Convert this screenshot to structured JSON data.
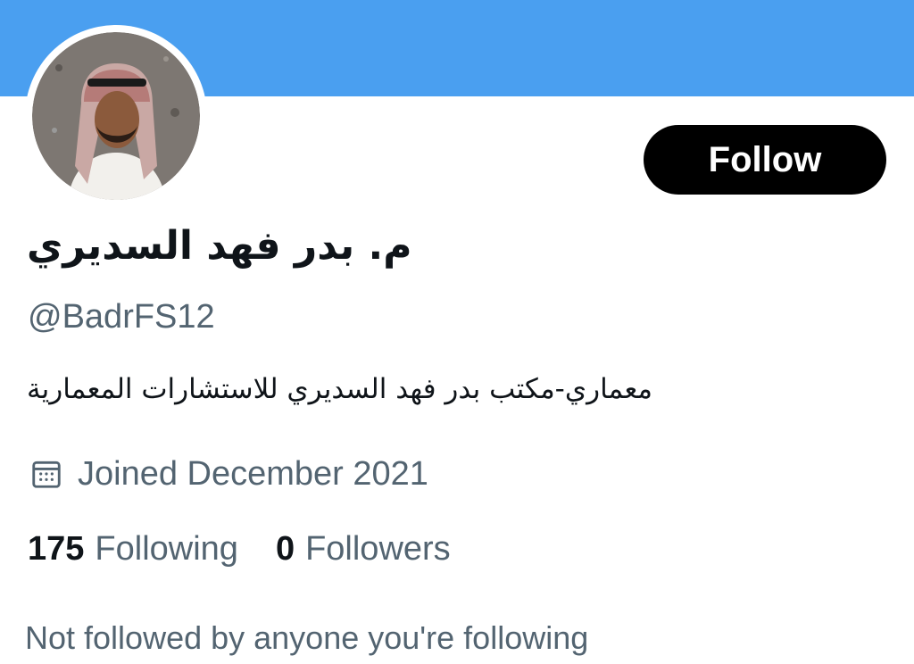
{
  "profile": {
    "display_name": "م. بدر فهد السديري",
    "handle": "@BadrFS12",
    "bio": "معماري-مكتب بدر فهد السديري للاستشارات المعمارية",
    "joined": "Joined December 2021",
    "following_count": "175",
    "following_label": "Following",
    "followers_count": "0",
    "followers_label": "Followers",
    "mutual_note": "Not followed by anyone you're following"
  },
  "actions": {
    "follow_label": "Follow"
  },
  "icons": {
    "joined": "calendar-icon"
  },
  "colors": {
    "banner": "#4a9ff0",
    "button": "#000000",
    "secondary_text": "#536471"
  }
}
